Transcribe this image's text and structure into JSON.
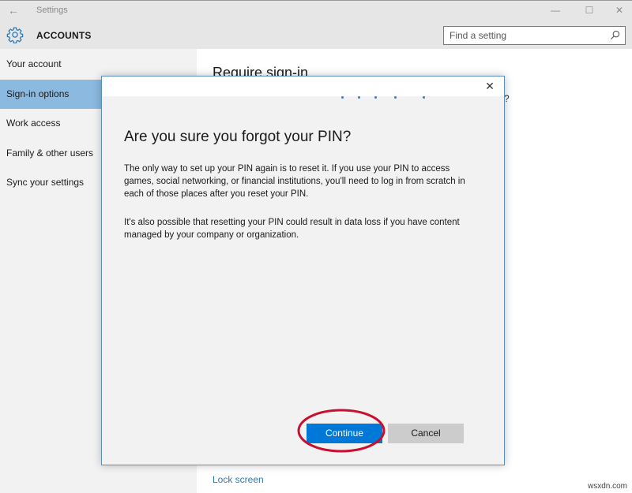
{
  "window": {
    "title": "Settings",
    "controls": {
      "minimize": "—",
      "maximize": "☐",
      "close": "✕"
    }
  },
  "header": {
    "icon": "gear-icon",
    "title": "ACCOUNTS",
    "search": {
      "placeholder": "Find a setting",
      "value": ""
    }
  },
  "sidebar": {
    "items": [
      {
        "label": "Your account",
        "active": false
      },
      {
        "label": "Sign-in options",
        "active": true
      },
      {
        "label": "Work access",
        "active": false
      },
      {
        "label": "Family & other users",
        "active": false
      },
      {
        "label": "Sync your settings",
        "active": false
      }
    ]
  },
  "main": {
    "heading": "Require sign-in",
    "partial_text": "?",
    "lock_screen_link": "Lock screen"
  },
  "dialog": {
    "close": "✕",
    "title": "Are you sure you forgot your PIN?",
    "paragraphs": [
      "The only way to set up your PIN again is to reset it. If you use your PIN to access games, social networking, or financial institutions, you'll need to log in from scratch in each of those places after you reset your PIN.",
      "It's also possible that resetting your PIN could result in data loss if you have content managed by your company or organization."
    ],
    "buttons": {
      "continue": "Continue",
      "cancel": "Cancel"
    }
  },
  "colors": {
    "accent": "#0078d7",
    "sidebar_active": "#8bb9e0",
    "link": "#3478a8",
    "annotation": "#c8102e"
  },
  "watermark": "wsxdn.com"
}
